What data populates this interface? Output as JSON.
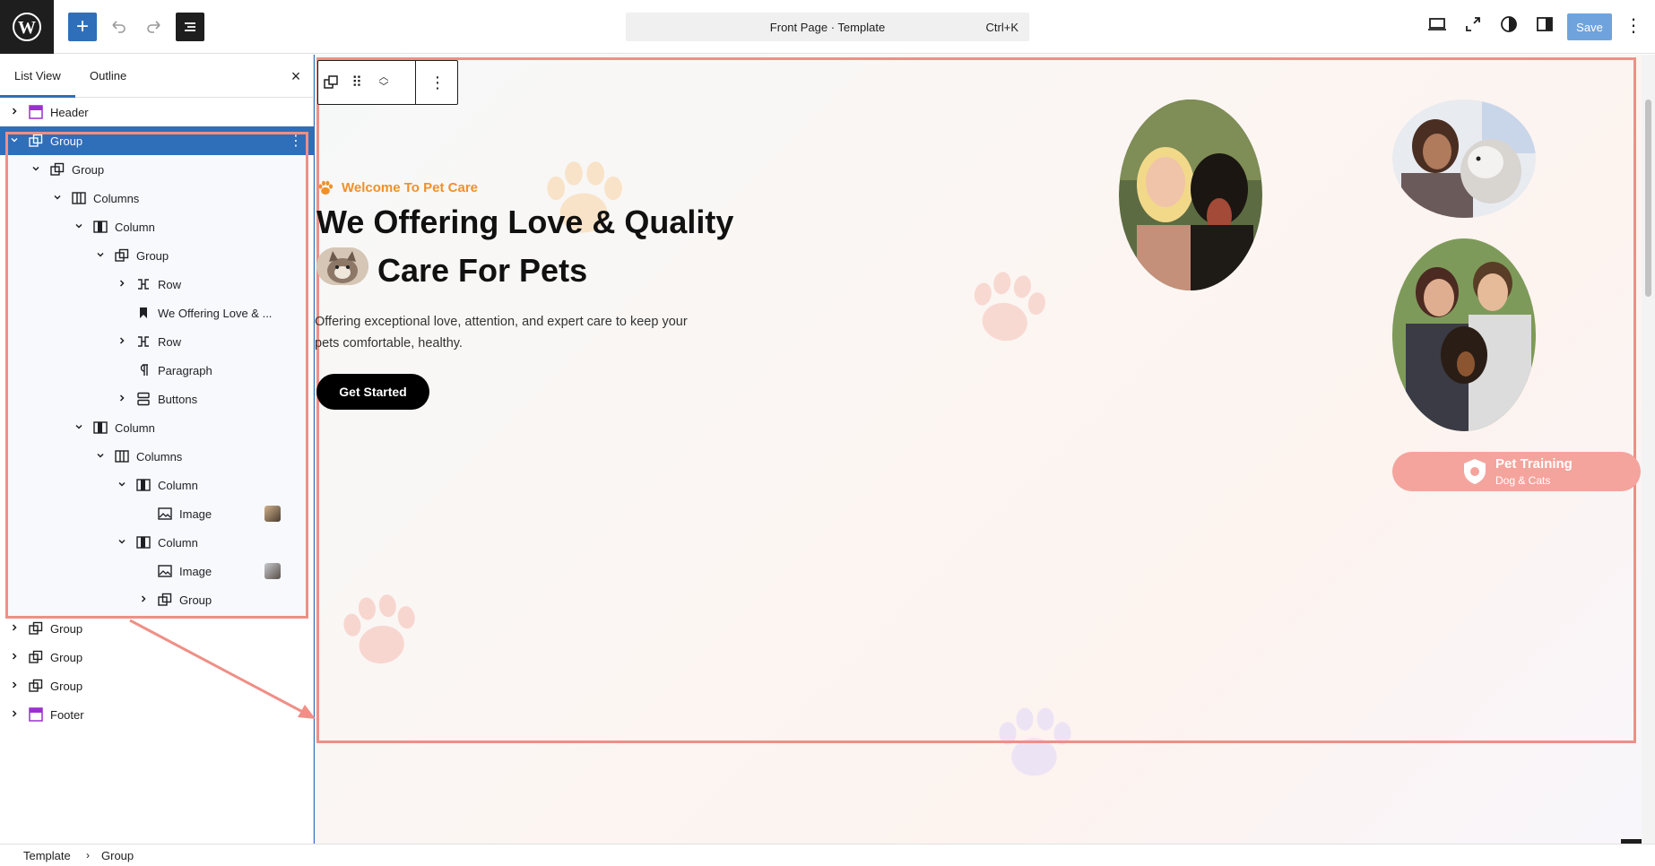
{
  "topbar": {
    "command_title": "Front Page · Template",
    "command_shortcut": "Ctrl+K",
    "save_label": "Save",
    "icons": [
      "wordpress-logo",
      "plus-icon",
      "undo-icon",
      "redo-icon",
      "list-view-icon",
      "desktop-view-icon",
      "fullscreen-icon",
      "contrast-icon",
      "sidebar-icon",
      "more-vertical-icon"
    ]
  },
  "panel": {
    "tabs": [
      {
        "label": "List View",
        "active": true
      },
      {
        "label": "Outline",
        "active": false
      }
    ],
    "close": "×",
    "tree": [
      {
        "label": "Header",
        "level": 0,
        "icon": "template-part-icon",
        "chevron": "right"
      },
      {
        "label": "Group",
        "level": 0,
        "icon": "group-icon",
        "chevron": "down",
        "selected": true
      },
      {
        "label": "Group",
        "level": 1,
        "icon": "group-icon",
        "chevron": "down"
      },
      {
        "label": "Columns",
        "level": 2,
        "icon": "columns-icon",
        "chevron": "down"
      },
      {
        "label": "Column",
        "level": 3,
        "icon": "column-icon",
        "chevron": "down"
      },
      {
        "label": "Group",
        "level": 4,
        "icon": "group-icon",
        "chevron": "down"
      },
      {
        "label": "Row",
        "level": 5,
        "icon": "row-icon",
        "chevron": "right"
      },
      {
        "label": "We Offering Love & ...",
        "level": 5,
        "icon": "heading-bookmark-icon",
        "chevron": ""
      },
      {
        "label": "Row",
        "level": 5,
        "icon": "row-icon",
        "chevron": "right"
      },
      {
        "label": "Paragraph",
        "level": 5,
        "icon": "paragraph-icon",
        "chevron": ""
      },
      {
        "label": "Buttons",
        "level": 5,
        "icon": "buttons-icon",
        "chevron": "right"
      },
      {
        "label": "Column",
        "level": 3,
        "icon": "column-icon",
        "chevron": "down"
      },
      {
        "label": "Columns",
        "level": 4,
        "icon": "columns-icon",
        "chevron": "down"
      },
      {
        "label": "Column",
        "level": 5,
        "icon": "column-icon",
        "chevron": "down"
      },
      {
        "label": "Image",
        "level": 6,
        "icon": "image-icon",
        "chevron": "",
        "thumb": true
      },
      {
        "label": "Column",
        "level": 5,
        "icon": "column-icon",
        "chevron": "down"
      },
      {
        "label": "Image",
        "level": 6,
        "icon": "image-icon",
        "chevron": "",
        "thumb": true
      },
      {
        "label": "Group",
        "level": 6,
        "icon": "group-icon",
        "chevron": "right"
      },
      {
        "label": "Group",
        "level": 0,
        "icon": "group-icon",
        "chevron": "right"
      },
      {
        "label": "Group",
        "level": 0,
        "icon": "group-icon",
        "chevron": "right"
      },
      {
        "label": "Group",
        "level": 0,
        "icon": "group-icon",
        "chevron": "right"
      },
      {
        "label": "Footer",
        "level": 0,
        "icon": "template-part-icon",
        "chevron": "right"
      }
    ]
  },
  "canvas": {
    "welcome": "Welcome To Pet Care",
    "headline_line1": "We Offering Love & Quality",
    "headline_line2": "Care For Pets",
    "description": "Offering exceptional love, attention, and expert care to keep your pets comfortable, healthy.",
    "cta_label": "Get Started",
    "badge_title": "Pet Training",
    "badge_subtitle": "Dog & Cats"
  },
  "breadcrumb": [
    "Template",
    "Group"
  ],
  "colors": {
    "accent": "#2f6fba",
    "annotation": "#ef8f86",
    "welcome": "#f0902a",
    "badge": "#f4a49d"
  }
}
